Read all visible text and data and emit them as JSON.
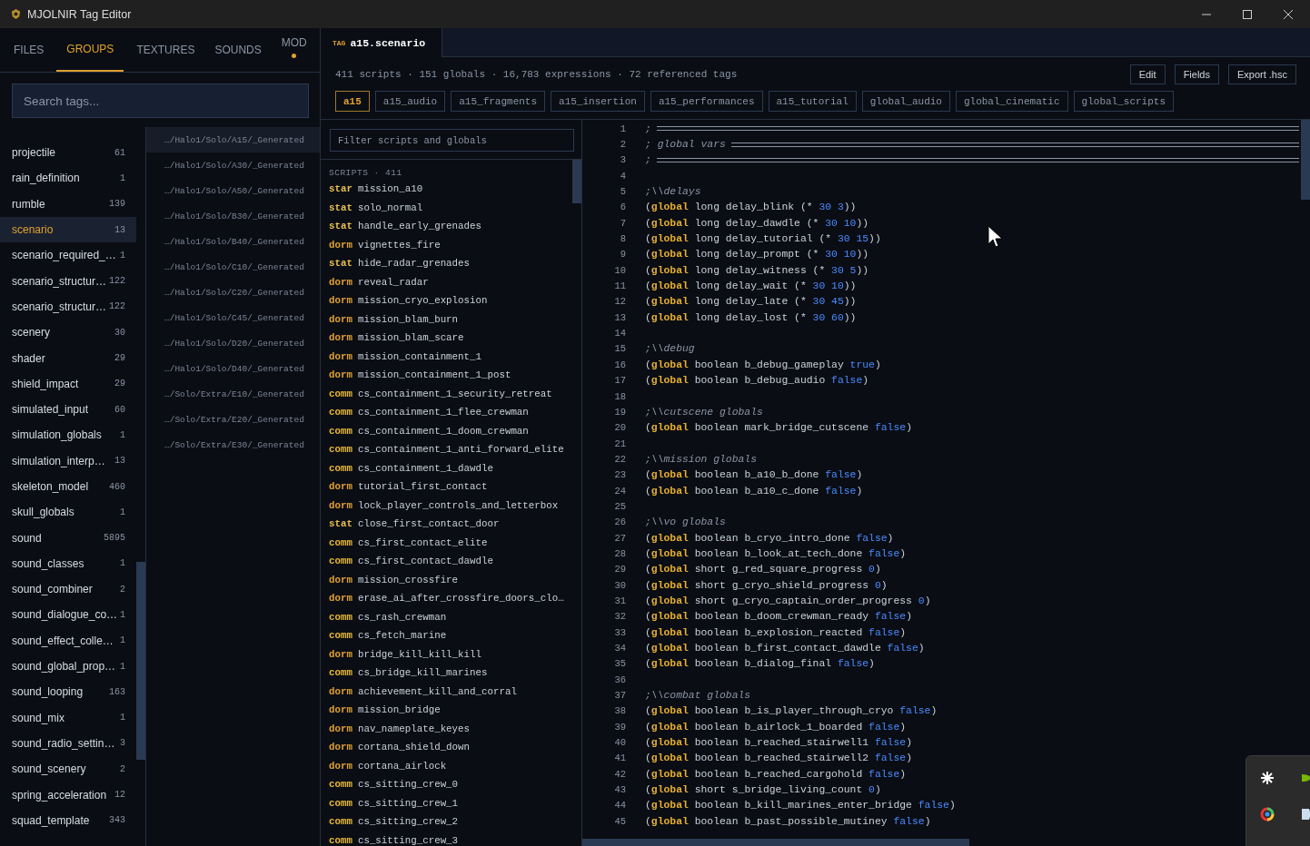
{
  "window": {
    "title": "MJOLNIR Tag Editor"
  },
  "side_tabs": [
    {
      "label": "FILES",
      "selected": false,
      "dot": false
    },
    {
      "label": "GROUPS",
      "selected": true,
      "dot": false
    },
    {
      "label": "TEXTURES",
      "selected": false,
      "dot": false
    },
    {
      "label": "SOUNDS",
      "selected": false,
      "dot": false
    },
    {
      "label": "MOD",
      "selected": false,
      "dot": true
    }
  ],
  "search": {
    "placeholder": "Search tags..."
  },
  "groups": [
    {
      "name": "projectile",
      "count": "61",
      "selected": false
    },
    {
      "name": "rain_definition",
      "count": "1",
      "selected": false
    },
    {
      "name": "rumble",
      "count": "139",
      "selected": false
    },
    {
      "name": "scenario",
      "count": "13",
      "selected": true
    },
    {
      "name": "scenario_required_…",
      "count": "1",
      "selected": false
    },
    {
      "name": "scenario_structur…",
      "count": "122",
      "selected": false
    },
    {
      "name": "scenario_structur…",
      "count": "122",
      "selected": false
    },
    {
      "name": "scenery",
      "count": "30",
      "selected": false
    },
    {
      "name": "shader",
      "count": "29",
      "selected": false
    },
    {
      "name": "shield_impact",
      "count": "29",
      "selected": false
    },
    {
      "name": "simulated_input",
      "count": "60",
      "selected": false
    },
    {
      "name": "simulation_globals",
      "count": "1",
      "selected": false
    },
    {
      "name": "simulation_interp…",
      "count": "13",
      "selected": false
    },
    {
      "name": "skeleton_model",
      "count": "460",
      "selected": false
    },
    {
      "name": "skull_globals",
      "count": "1",
      "selected": false
    },
    {
      "name": "sound",
      "count": "5895",
      "selected": false
    },
    {
      "name": "sound_classes",
      "count": "1",
      "selected": false
    },
    {
      "name": "sound_combiner",
      "count": "2",
      "selected": false
    },
    {
      "name": "sound_dialogue_co…",
      "count": "1",
      "selected": false
    },
    {
      "name": "sound_effect_colle…",
      "count": "1",
      "selected": false
    },
    {
      "name": "sound_global_prop…",
      "count": "1",
      "selected": false
    },
    {
      "name": "sound_looping",
      "count": "163",
      "selected": false
    },
    {
      "name": "sound_mix",
      "count": "1",
      "selected": false
    },
    {
      "name": "sound_radio_settin…",
      "count": "3",
      "selected": false
    },
    {
      "name": "sound_scenery",
      "count": "2",
      "selected": false
    },
    {
      "name": "spring_acceleration",
      "count": "12",
      "selected": false
    },
    {
      "name": "squad_template",
      "count": "343",
      "selected": false
    }
  ],
  "paths": [
    {
      "text": "…/Halo1/Solo/A15/_Generated",
      "selected": true
    },
    {
      "text": "…/Halo1/Solo/A30/_Generated",
      "selected": false
    },
    {
      "text": "…/Halo1/Solo/A50/_Generated",
      "selected": false
    },
    {
      "text": "…/Halo1/Solo/B30/_Generated",
      "selected": false
    },
    {
      "text": "…/Halo1/Solo/B40/_Generated",
      "selected": false
    },
    {
      "text": "…/Halo1/Solo/C10/_Generated",
      "selected": false
    },
    {
      "text": "…/Halo1/Solo/C20/_Generated",
      "selected": false
    },
    {
      "text": "…/Halo1/Solo/C45/_Generated",
      "selected": false
    },
    {
      "text": "…/Halo1/Solo/D20/_Generated",
      "selected": false
    },
    {
      "text": "…/Halo1/Solo/D40/_Generated",
      "selected": false
    },
    {
      "text": "…/Solo/Extra/E10/_Generated",
      "selected": false
    },
    {
      "text": "…/Solo/Extra/E20/_Generated",
      "selected": false
    },
    {
      "text": "…/Solo/Extra/E30/_Generated",
      "selected": false
    }
  ],
  "tag_tab": {
    "badge": "TAG",
    "title": "a15.scenario"
  },
  "summary": "411 scripts · 151 globals · 16,783 expressions · 72 referenced tags",
  "actions": [
    "Edit",
    "Fields",
    "Export .hsc"
  ],
  "source_chips": [
    {
      "label": "a15",
      "selected": true
    },
    {
      "label": "a15_audio",
      "selected": false
    },
    {
      "label": "a15_fragments",
      "selected": false
    },
    {
      "label": "a15_insertion",
      "selected": false
    },
    {
      "label": "a15_performances",
      "selected": false
    },
    {
      "label": "a15_tutorial",
      "selected": false
    },
    {
      "label": "global_audio",
      "selected": false
    },
    {
      "label": "global_cinematic",
      "selected": false
    },
    {
      "label": "global_scripts",
      "selected": false
    }
  ],
  "filter": {
    "placeholder": "Filter scripts and globals"
  },
  "scripts_heading": "SCRIPTS · 411",
  "scripts": [
    {
      "type": "star",
      "name": "mission_a10"
    },
    {
      "type": "stat",
      "name": "solo_normal"
    },
    {
      "type": "stat",
      "name": "handle_early_grenades"
    },
    {
      "type": "dorm",
      "name": "vignettes_fire"
    },
    {
      "type": "stat",
      "name": "hide_radar_grenades"
    },
    {
      "type": "dorm",
      "name": "reveal_radar"
    },
    {
      "type": "dorm",
      "name": "mission_cryo_explosion"
    },
    {
      "type": "dorm",
      "name": "mission_blam_burn"
    },
    {
      "type": "dorm",
      "name": "mission_blam_scare"
    },
    {
      "type": "dorm",
      "name": "mission_containment_1"
    },
    {
      "type": "dorm",
      "name": "mission_containment_1_post"
    },
    {
      "type": "comm",
      "name": "cs_containment_1_security_retreat"
    },
    {
      "type": "comm",
      "name": "cs_containment_1_flee_crewman"
    },
    {
      "type": "comm",
      "name": "cs_containment_1_doom_crewman"
    },
    {
      "type": "comm",
      "name": "cs_containment_1_anti_forward_elite"
    },
    {
      "type": "comm",
      "name": "cs_containment_1_dawdle"
    },
    {
      "type": "dorm",
      "name": "tutorial_first_contact"
    },
    {
      "type": "dorm",
      "name": "lock_player_controls_and_letterbox"
    },
    {
      "type": "stat",
      "name": "close_first_contact_door"
    },
    {
      "type": "comm",
      "name": "cs_first_contact_elite"
    },
    {
      "type": "comm",
      "name": "cs_first_contact_dawdle"
    },
    {
      "type": "dorm",
      "name": "mission_crossfire"
    },
    {
      "type": "dorm",
      "name": "erase_ai_after_crossfire_doors_clo…"
    },
    {
      "type": "comm",
      "name": "cs_rash_crewman"
    },
    {
      "type": "comm",
      "name": "cs_fetch_marine"
    },
    {
      "type": "dorm",
      "name": "bridge_kill_kill_kill"
    },
    {
      "type": "comm",
      "name": "cs_bridge_kill_marines"
    },
    {
      "type": "dorm",
      "name": "achievement_kill_and_corral"
    },
    {
      "type": "dorm",
      "name": "mission_bridge"
    },
    {
      "type": "dorm",
      "name": "nav_nameplate_keyes"
    },
    {
      "type": "dorm",
      "name": "cortana_shield_down"
    },
    {
      "type": "dorm",
      "name": "cortana_airlock"
    },
    {
      "type": "comm",
      "name": "cs_sitting_crew_0"
    },
    {
      "type": "comm",
      "name": "cs_sitting_crew_1"
    },
    {
      "type": "comm",
      "name": "cs_sitting_crew_2"
    },
    {
      "type": "comm",
      "name": "cs_sitting_crew_3"
    }
  ],
  "code_lines": [
    {
      "n": "1",
      "kind": "rule",
      "text": ";"
    },
    {
      "n": "2",
      "kind": "rule",
      "text": "; global vars"
    },
    {
      "n": "3",
      "kind": "rule",
      "text": ";"
    },
    {
      "n": "4",
      "kind": "blank"
    },
    {
      "n": "5",
      "kind": "comment",
      "text": ";\\\\delays"
    },
    {
      "n": "6",
      "kind": "code",
      "open": "(",
      "keyword": "global",
      "body": " long delay_blink (* ",
      "value": "30 3",
      "close": "))"
    },
    {
      "n": "7",
      "kind": "code",
      "open": "(",
      "keyword": "global",
      "body": " long delay_dawdle (* ",
      "value": "30 10",
      "close": "))"
    },
    {
      "n": "8",
      "kind": "code",
      "open": "(",
      "keyword": "global",
      "body": " long delay_tutorial (* ",
      "value": "30 15",
      "close": "))"
    },
    {
      "n": "9",
      "kind": "code",
      "open": "(",
      "keyword": "global",
      "body": " long delay_prompt (* ",
      "value": "30 10",
      "close": "))"
    },
    {
      "n": "10",
      "kind": "code",
      "open": "(",
      "keyword": "global",
      "body": " long delay_witness (* ",
      "value": "30 5",
      "close": "))"
    },
    {
      "n": "11",
      "kind": "code",
      "open": "(",
      "keyword": "global",
      "body": " long delay_wait (* ",
      "value": "30 10",
      "close": "))"
    },
    {
      "n": "12",
      "kind": "code",
      "open": "(",
      "keyword": "global",
      "body": " long delay_late (* ",
      "value": "30 45",
      "close": "))"
    },
    {
      "n": "13",
      "kind": "code",
      "open": "(",
      "keyword": "global",
      "body": " long delay_lost (* ",
      "value": "30 60",
      "close": "))"
    },
    {
      "n": "14",
      "kind": "blank"
    },
    {
      "n": "15",
      "kind": "comment",
      "text": ";\\\\debug"
    },
    {
      "n": "16",
      "kind": "code",
      "open": "(",
      "keyword": "global",
      "body": " boolean b_debug_gameplay ",
      "value": "true",
      "close": ")"
    },
    {
      "n": "17",
      "kind": "code",
      "open": "(",
      "keyword": "global",
      "body": " boolean b_debug_audio ",
      "value": "false",
      "close": ")"
    },
    {
      "n": "18",
      "kind": "blank"
    },
    {
      "n": "19",
      "kind": "comment",
      "text": ";\\\\cutscene globals"
    },
    {
      "n": "20",
      "kind": "code",
      "open": "(",
      "keyword": "global",
      "body": " boolean mark_bridge_cutscene ",
      "value": "false",
      "close": ")"
    },
    {
      "n": "21",
      "kind": "blank"
    },
    {
      "n": "22",
      "kind": "comment",
      "text": ";\\\\mission globals"
    },
    {
      "n": "23",
      "kind": "code",
      "open": "(",
      "keyword": "global",
      "body": " boolean b_a10_b_done ",
      "value": "false",
      "close": ")"
    },
    {
      "n": "24",
      "kind": "code",
      "open": "(",
      "keyword": "global",
      "body": " boolean b_a10_c_done ",
      "value": "false",
      "close": ")"
    },
    {
      "n": "25",
      "kind": "blank"
    },
    {
      "n": "26",
      "kind": "comment",
      "text": ";\\\\vo globals"
    },
    {
      "n": "27",
      "kind": "code",
      "open": "(",
      "keyword": "global",
      "body": " boolean b_cryo_intro_done ",
      "value": "false",
      "close": ")"
    },
    {
      "n": "28",
      "kind": "code",
      "open": "(",
      "keyword": "global",
      "body": " boolean b_look_at_tech_done ",
      "value": "false",
      "close": ")"
    },
    {
      "n": "29",
      "kind": "code",
      "open": "(",
      "keyword": "global",
      "body": " short g_red_square_progress ",
      "value": "0",
      "close": ")"
    },
    {
      "n": "30",
      "kind": "code",
      "open": "(",
      "keyword": "global",
      "body": " short g_cryo_shield_progress ",
      "value": "0",
      "close": ")"
    },
    {
      "n": "31",
      "kind": "code",
      "open": "(",
      "keyword": "global",
      "body": " short g_cryo_captain_order_progress ",
      "value": "0",
      "close": ")"
    },
    {
      "n": "32",
      "kind": "code",
      "open": "(",
      "keyword": "global",
      "body": " boolean b_doom_crewman_ready ",
      "value": "false",
      "close": ")"
    },
    {
      "n": "33",
      "kind": "code",
      "open": "(",
      "keyword": "global",
      "body": " boolean b_explosion_reacted ",
      "value": "false",
      "close": ")"
    },
    {
      "n": "34",
      "kind": "code",
      "open": "(",
      "keyword": "global",
      "body": " boolean b_first_contact_dawdle ",
      "value": "false",
      "close": ")"
    },
    {
      "n": "35",
      "kind": "code",
      "open": "(",
      "keyword": "global",
      "body": " boolean b_dialog_final ",
      "value": "false",
      "close": ")"
    },
    {
      "n": "36",
      "kind": "blank"
    },
    {
      "n": "37",
      "kind": "comment",
      "text": ";\\\\combat globals"
    },
    {
      "n": "38",
      "kind": "code",
      "open": "(",
      "keyword": "global",
      "body": " boolean b_is_player_through_cryo ",
      "value": "false",
      "close": ")"
    },
    {
      "n": "39",
      "kind": "code",
      "open": "(",
      "keyword": "global",
      "body": " boolean b_airlock_1_boarded ",
      "value": "false",
      "close": ")"
    },
    {
      "n": "40",
      "kind": "code",
      "open": "(",
      "keyword": "global",
      "body": " boolean b_reached_stairwell1 ",
      "value": "false",
      "close": ")"
    },
    {
      "n": "41",
      "kind": "code",
      "open": "(",
      "keyword": "global",
      "body": " boolean b_reached_stairwell2 ",
      "value": "false",
      "close": ")"
    },
    {
      "n": "42",
      "kind": "code",
      "open": "(",
      "keyword": "global",
      "body": " boolean b_reached_cargohold ",
      "value": "false",
      "close": ")"
    },
    {
      "n": "43",
      "kind": "code",
      "open": "(",
      "keyword": "global",
      "body": " short s_bridge_living_count ",
      "value": "0",
      "close": ")"
    },
    {
      "n": "44",
      "kind": "code",
      "open": "(",
      "keyword": "global",
      "body": " boolean b_kill_marines_enter_bridge ",
      "value": "false",
      "close": ")"
    },
    {
      "n": "45",
      "kind": "code",
      "open": "(",
      "keyword": "global",
      "body": " boolean b_past_possible_mutiney ",
      "value": "false",
      "close": ")"
    }
  ]
}
